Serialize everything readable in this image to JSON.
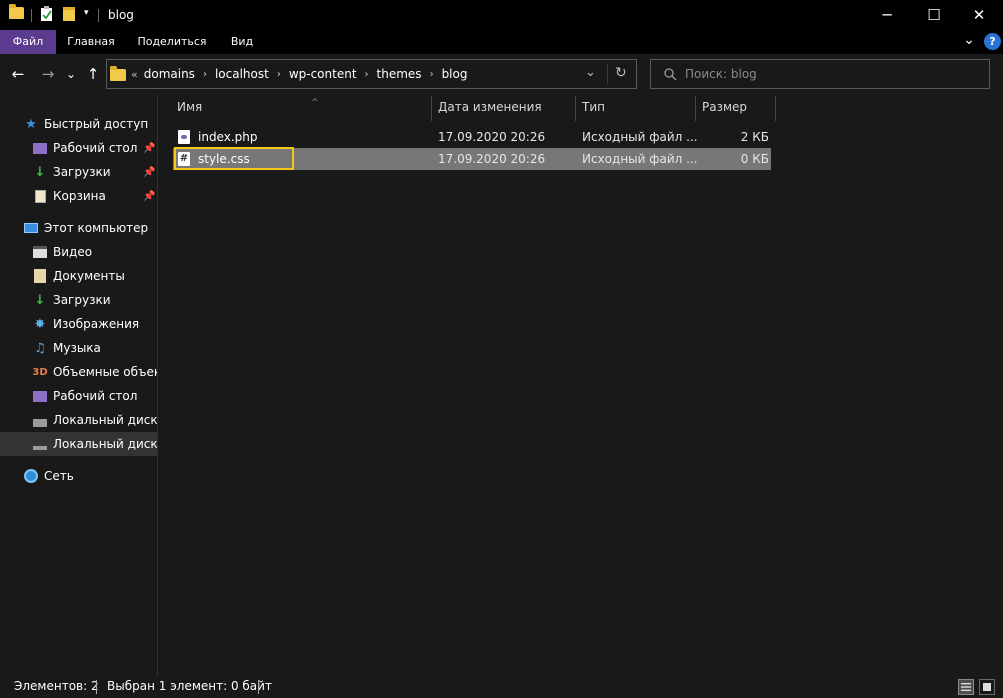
{
  "window": {
    "title": "blog",
    "minimize_glyph": "─",
    "maximize_glyph": "☐",
    "close_glyph": "✕"
  },
  "ribbon": {
    "tabs": [
      {
        "label": "Файл",
        "active": true
      },
      {
        "label": "Главная"
      },
      {
        "label": "Поделиться"
      },
      {
        "label": "Вид"
      }
    ],
    "expand_glyph": "⌄",
    "help_glyph": "?"
  },
  "nav": {
    "back_glyph": "←",
    "forward_glyph": "→",
    "recent_glyph": "⌄",
    "up_glyph": "↑",
    "overflow_glyph": "«",
    "breadcrumbs": [
      "domains",
      "localhost",
      "wp-content",
      "themes",
      "blog"
    ],
    "crumb_separator": "›",
    "history_glyph": "⌄",
    "refresh_glyph": "↻",
    "search_placeholder": "Поиск: blog"
  },
  "sidebar": {
    "quick_access": "Быстрый доступ",
    "quick_items": [
      {
        "label": "Рабочий стол",
        "icon": "desktop-icon",
        "pinned": true
      },
      {
        "label": "Загрузки",
        "icon": "downloads-icon",
        "pinned": true
      },
      {
        "label": "Корзина",
        "icon": "recycle-bin-icon",
        "pinned": true
      }
    ],
    "this_pc": "Этот компьютер",
    "pc_items": [
      {
        "label": "Видео",
        "icon": "video-icon"
      },
      {
        "label": "Документы",
        "icon": "documents-icon"
      },
      {
        "label": "Загрузки",
        "icon": "downloads-icon"
      },
      {
        "label": "Изображения",
        "icon": "pictures-icon"
      },
      {
        "label": "Музыка",
        "icon": "music-icon"
      },
      {
        "label": "Объемные объекты",
        "icon": "3d-objects-icon"
      },
      {
        "label": "Рабочий стол",
        "icon": "desktop-icon"
      },
      {
        "label": "Локальный диск (C:)",
        "icon": "drive-icon"
      },
      {
        "label": "Локальный диск (D:)",
        "icon": "drive-icon",
        "selected": true
      }
    ],
    "network": "Сеть",
    "pin_glyph": "📌"
  },
  "columns": {
    "name": "Имя",
    "date": "Дата изменения",
    "type": "Тип",
    "size": "Размер",
    "sort_glyph": "^"
  },
  "files": [
    {
      "name": "index.php",
      "date": "17.09.2020 20:26",
      "type": "Исходный файл ...",
      "size": "2 КБ",
      "icon": "php-file-icon",
      "selected": false
    },
    {
      "name": "style.css",
      "date": "17.09.2020 20:26",
      "type": "Исходный файл ...",
      "size": "0 КБ",
      "icon": "css-file-icon",
      "selected": true
    }
  ],
  "status": {
    "items_count": "Элементов: 2",
    "selection": "Выбран 1 элемент: 0 байт"
  },
  "colors": {
    "accent_file_tab": "#5a3b8d",
    "selection_highlight": "#777777",
    "focus_outline": "#f4c81b",
    "folder": "#f3c94a"
  }
}
